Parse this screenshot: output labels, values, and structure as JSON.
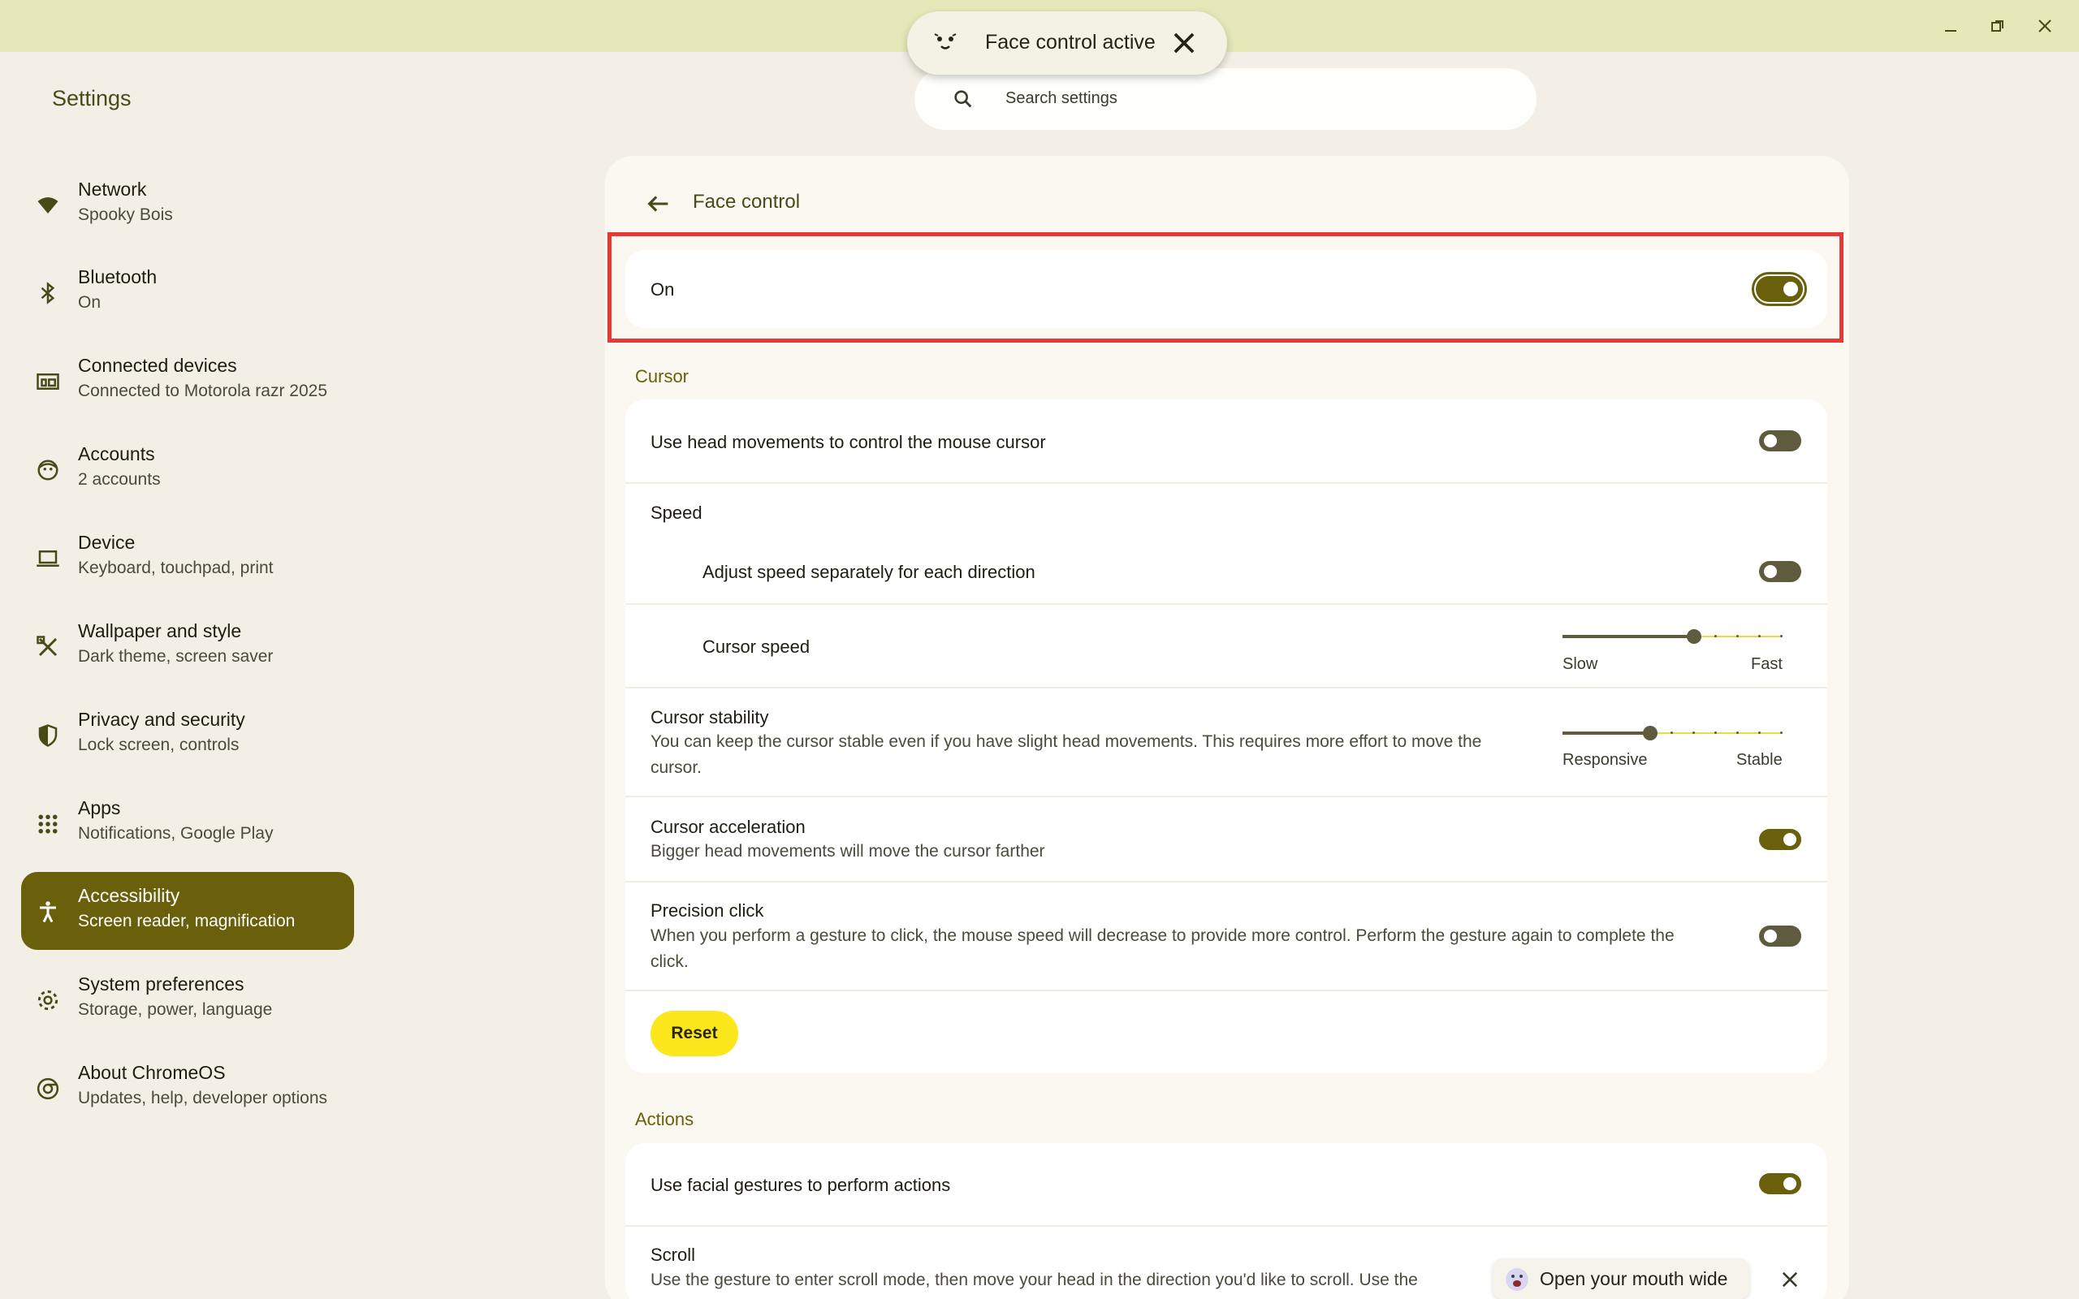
{
  "app": {
    "title": "Settings"
  },
  "toast": {
    "text": "Face control active"
  },
  "search": {
    "placeholder": "Search settings"
  },
  "sidebar": {
    "items": [
      {
        "label": "Network",
        "sub": "Spooky Bois"
      },
      {
        "label": "Bluetooth",
        "sub": "On"
      },
      {
        "label": "Connected devices",
        "sub": "Connected to Motorola razr 2025"
      },
      {
        "label": "Accounts",
        "sub": "2 accounts"
      },
      {
        "label": "Device",
        "sub": "Keyboard, touchpad, print"
      },
      {
        "label": "Wallpaper and style",
        "sub": "Dark theme, screen saver"
      },
      {
        "label": "Privacy and security",
        "sub": "Lock screen, controls"
      },
      {
        "label": "Apps",
        "sub": "Notifications, Google Play"
      },
      {
        "label": "Accessibility",
        "sub": "Screen reader, magnification"
      },
      {
        "label": "System preferences",
        "sub": "Storage, power, language"
      },
      {
        "label": "About ChromeOS",
        "sub": "Updates, help, developer options"
      }
    ],
    "active_index": 8
  },
  "page": {
    "title": "Face control",
    "main_toggle": {
      "label": "On",
      "state": true
    },
    "cursor_section": "Cursor",
    "head_movements": {
      "label": "Use head movements to control the mouse cursor",
      "state": false
    },
    "speed_heading": "Speed",
    "adjust_speed": {
      "label": "Adjust speed separately for each direction",
      "state": false
    },
    "cursor_speed": {
      "label": "Cursor speed",
      "min_label": "Slow",
      "max_label": "Fast",
      "step": 6,
      "steps": 10
    },
    "cursor_stability": {
      "label": "Cursor stability",
      "desc": "You can keep the cursor stable even if you have slight head movements. This requires more effort to move the cursor.",
      "min_label": "Responsive",
      "max_label": "Stable",
      "step": 4,
      "steps": 10
    },
    "cursor_acceleration": {
      "label": "Cursor acceleration",
      "desc": "Bigger head movements will move the cursor farther",
      "state": true
    },
    "precision_click": {
      "label": "Precision click",
      "desc": "When you perform a gesture to click, the mouse speed will decrease to provide more control. Perform the gesture again to complete the click.",
      "state": false
    },
    "reset_label": "Reset",
    "actions_section": "Actions",
    "facial_gestures": {
      "label": "Use facial gestures to perform actions",
      "state": true
    },
    "scroll": {
      "label": "Scroll",
      "desc": "Use the gesture to enter scroll mode, then move your head in the direction you'd like to scroll. Use the"
    },
    "gesture_chip": {
      "text": "Open your mouth wide"
    }
  },
  "colors": {
    "accent": "#6a5f0a",
    "titlebar": "#e6e8b9",
    "highlight": "#e53935",
    "reset": "#fbe71b"
  }
}
